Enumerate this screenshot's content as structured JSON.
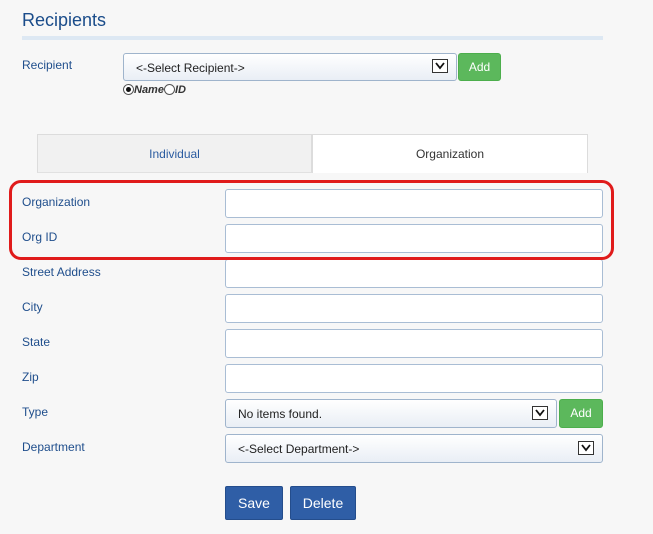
{
  "header": {
    "title": "Recipients"
  },
  "recipient": {
    "label": "Recipient",
    "select_value": "<-Select Recipient->",
    "add_label": "Add",
    "radio_name": "Name",
    "radio_id": "ID",
    "selected_radio": "Name"
  },
  "tabs": [
    {
      "label": "Individual",
      "active": false
    },
    {
      "label": "Organization",
      "active": true
    }
  ],
  "form": {
    "organization_label": "Organization",
    "org_id_label": "Org ID",
    "street_label": "Street Address",
    "city_label": "City",
    "state_label": "State",
    "zip_label": "Zip",
    "type_label": "Type",
    "type_value": "No items found.",
    "type_add_label": "Add",
    "department_label": "Department",
    "department_value": "<-Select Department->"
  },
  "actions": {
    "save_label": "Save",
    "delete_label": "Delete"
  },
  "colors": {
    "accent": "#2f5ea6",
    "add_button": "#5cb85c",
    "highlight": "#e01b1b",
    "label_text": "#1f4e8c"
  }
}
